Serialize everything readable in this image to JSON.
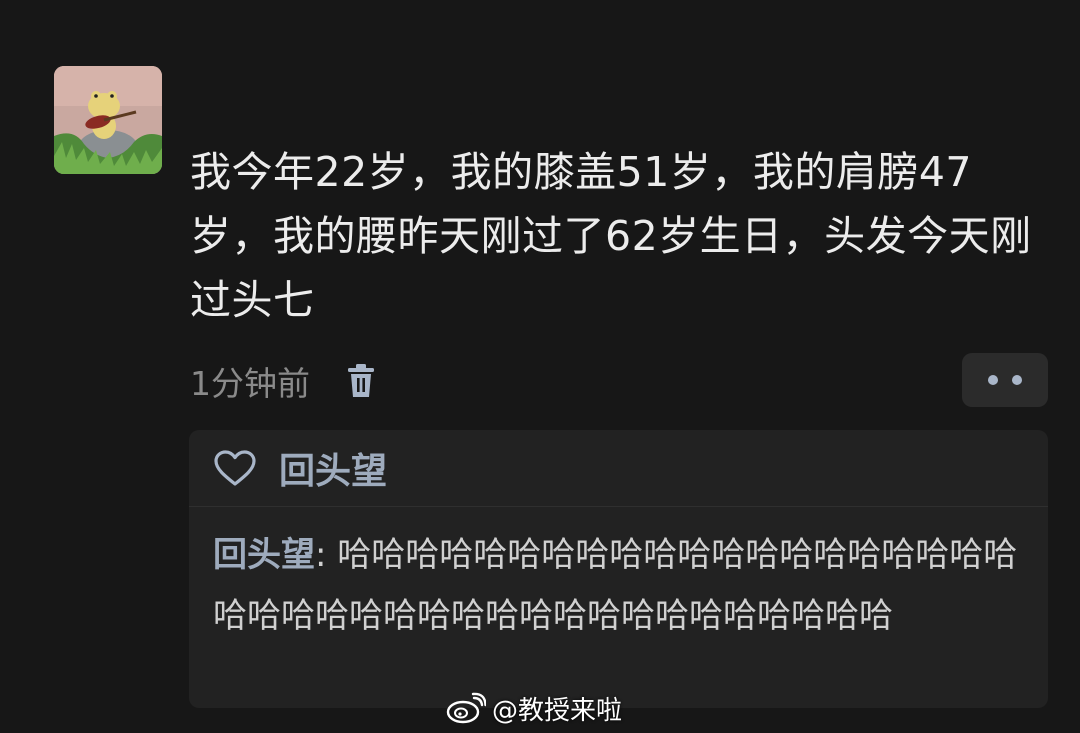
{
  "post": {
    "text": "我今年22岁，我的膝盖51岁，我的肩膀47岁，我的腰昨天刚过了62岁生日，头发今天刚过头七",
    "timestamp": "1分钟前"
  },
  "icons": {
    "avatar": "frog-playing-guitar-avatar",
    "delete": "trash-icon",
    "more": "more-dots-icon",
    "like": "heart-outline-icon",
    "watermark": "weibo-logo"
  },
  "likes": {
    "name": "回头望"
  },
  "comment": {
    "author": "回头望",
    "separator": ": ",
    "text": "哈哈哈哈哈哈哈哈哈哈哈哈哈哈哈哈哈哈哈哈哈哈哈哈哈哈哈哈哈哈哈哈哈哈哈哈哈哈哈哈"
  },
  "watermark": {
    "text": "@教授来啦"
  },
  "colors": {
    "background": "#171717",
    "card": "#222222",
    "accent_name": "#9eabbd",
    "timestamp": "#8a8a8a"
  }
}
